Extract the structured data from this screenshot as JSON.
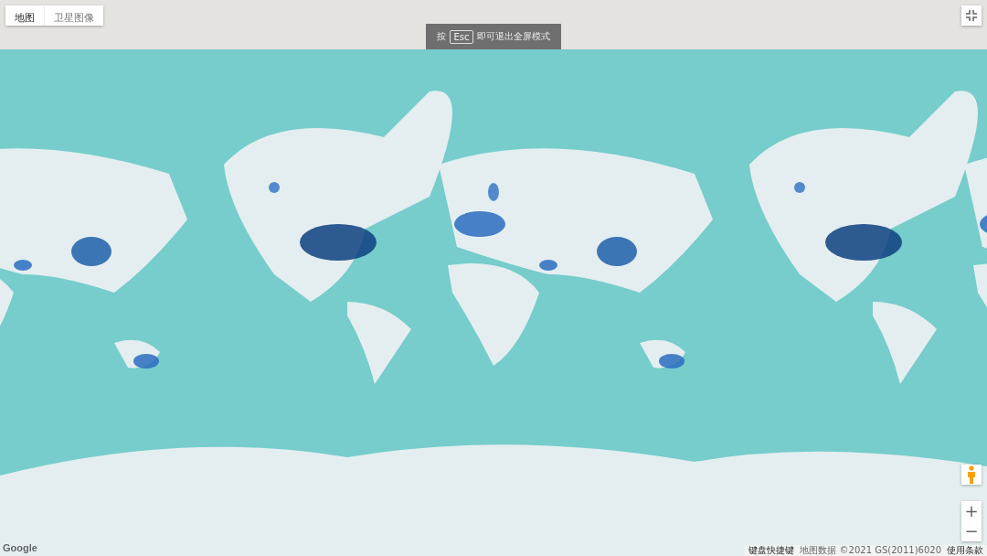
{
  "map_type_tabs": [
    {
      "label": "地图",
      "selected": true
    },
    {
      "label": "卫星图像",
      "selected": false
    }
  ],
  "fullscreen_hint": {
    "before": "按",
    "key": "Esc",
    "after": "即可退出全屏模式"
  },
  "zoom_controls": {
    "zoom_in": "+",
    "zoom_out": "−"
  },
  "logo": "Google",
  "footer_links": [
    {
      "kind": "link",
      "text": "键盘快捷键"
    },
    {
      "kind": "text",
      "text": "地图数据 ©2021 GS(2011)6020"
    },
    {
      "kind": "link",
      "text": "使用条款"
    }
  ]
}
